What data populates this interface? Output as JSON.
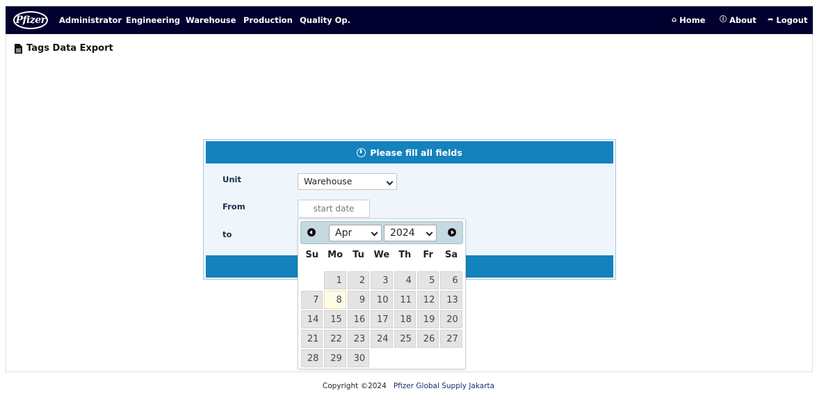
{
  "navbar": {
    "logo": "Pfizer",
    "menu": [
      "Administrator",
      "Engineering",
      "Warehouse",
      "Production",
      "Quality Op."
    ],
    "right": [
      {
        "icon": "home-icon",
        "label": "Home"
      },
      {
        "icon": "info-icon",
        "label": "About"
      },
      {
        "icon": "logout-icon",
        "label": "Logout"
      }
    ]
  },
  "page": {
    "title": "Tags Data Export",
    "title_icon": "document-icon"
  },
  "form": {
    "header": "Please fill all fields",
    "unit_label": "Unit",
    "unit_value": "Warehouse",
    "from_label": "From",
    "from_placeholder": "start date",
    "to_label": "to"
  },
  "datepicker": {
    "month": "Apr",
    "year": "2024",
    "today": 8,
    "days_of_week": [
      "Su",
      "Mo",
      "Tu",
      "We",
      "Th",
      "Fr",
      "Sa"
    ],
    "weeks": [
      [
        null,
        1,
        2,
        3,
        4,
        5,
        6
      ],
      [
        7,
        8,
        9,
        10,
        11,
        12,
        13
      ],
      [
        14,
        15,
        16,
        17,
        18,
        19,
        20
      ],
      [
        21,
        22,
        23,
        24,
        25,
        26,
        27
      ],
      [
        28,
        29,
        30,
        null,
        null,
        null,
        null
      ]
    ]
  },
  "footer": {
    "copyright": "Copyright ©2024",
    "company": "Pfizer Global Supply Jakarta"
  },
  "colors": {
    "navbar": "#02002e",
    "panel_header": "#1482bd",
    "panel_bg": "#eef6fc",
    "datepicker_header": "#c5d9e1"
  }
}
